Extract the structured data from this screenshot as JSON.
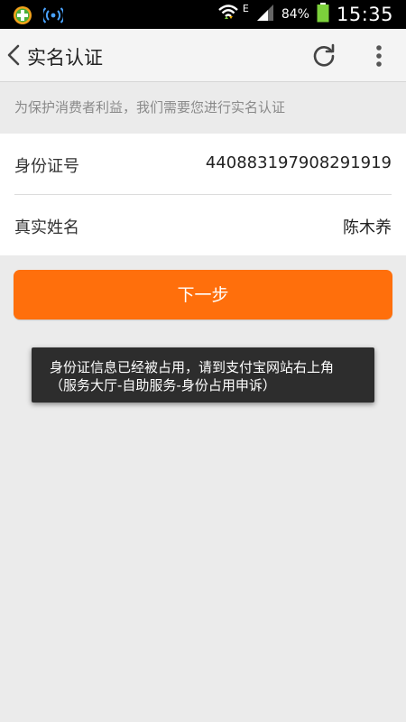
{
  "status_bar": {
    "battery_percent": "84%",
    "network_type": "E",
    "time": "15:35",
    "icons": [
      "app-plus-icon",
      "wifi-signal-app-icon",
      "wifi-icon",
      "cell-signal-icon",
      "battery-icon"
    ]
  },
  "app_bar": {
    "title": "实名认证",
    "icons": [
      "back-chevron-icon",
      "refresh-icon",
      "overflow-menu-icon"
    ]
  },
  "notice": "为保护消费者利益，我们需要您进行实名认证",
  "form": {
    "id_number": {
      "label": "身份证号",
      "value": "440883197908291919"
    },
    "real_name": {
      "label": "真实姓名",
      "value": "陈木养"
    }
  },
  "next_button": "下一步",
  "toast": "身份证信息已经被占用，请到支付宝网站右上角（服务大厅-自助服务-身份占用申诉）",
  "colors": {
    "accent": "#ff6f0c",
    "background": "#ebebeb",
    "toast_bg": "#2d2d2d"
  }
}
